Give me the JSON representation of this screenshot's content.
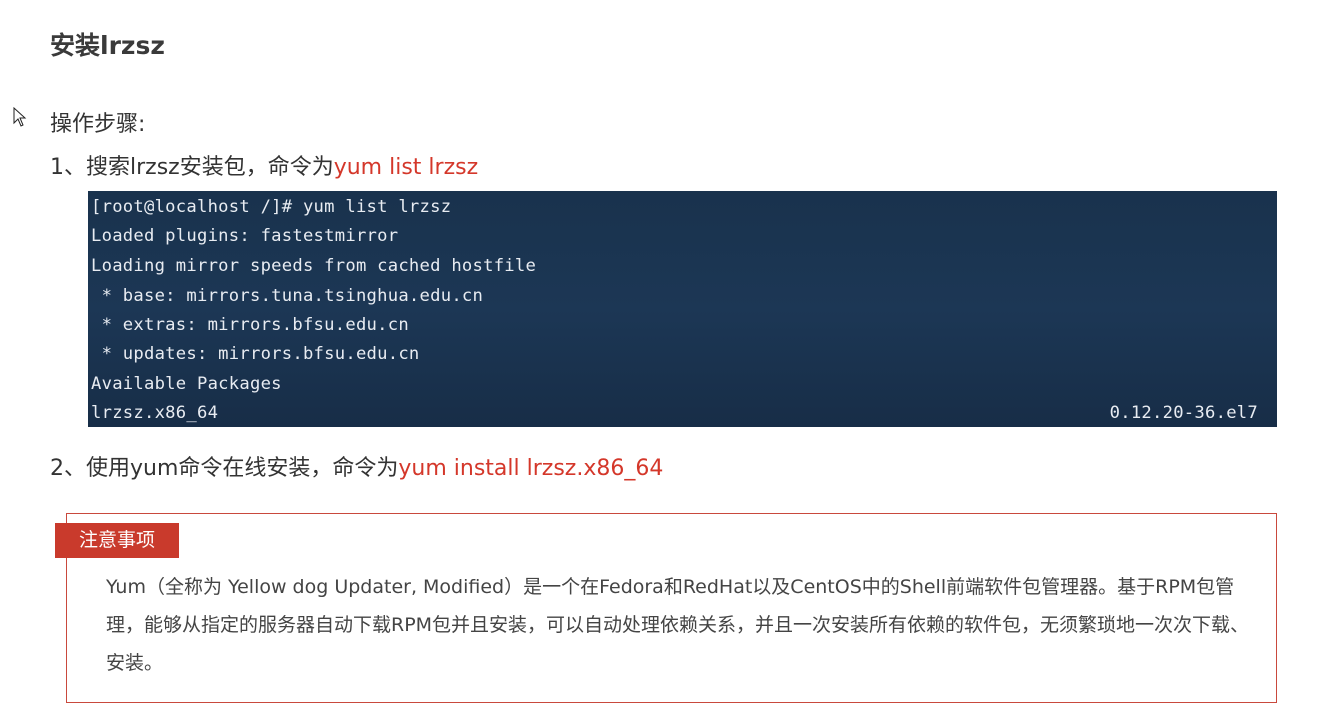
{
  "heading": "安装lrzsz",
  "steps_label": "操作步骤:",
  "step1": {
    "text": "1、搜索lrzsz安装包，命令为",
    "command": "yum list lrzsz"
  },
  "terminal": {
    "lines": [
      "[root@localhost /]# yum list lrzsz",
      "Loaded plugins: fastestmirror",
      "Loading mirror speeds from cached hostfile",
      " * base: mirrors.tuna.tsinghua.edu.cn",
      " * extras: mirrors.bfsu.edu.cn",
      " * updates: mirrors.bfsu.edu.cn",
      "Available Packages",
      "lrzsz.x86_64"
    ],
    "version": "0.12.20-36.el7"
  },
  "step2": {
    "text": "2、使用yum命令在线安装，命令为",
    "command": "yum install lrzsz.x86_64"
  },
  "note": {
    "tag": "注意事项",
    "text": "Yum（全称为 Yellow dog Updater, Modified）是一个在Fedora和RedHat以及CentOS中的Shell前端软件包管理器。基于RPM包管理，能够从指定的服务器自动下载RPM包并且安装，可以自动处理依赖关系，并且一次安装所有依赖的软件包，无须繁琐地一次次下载、安装。"
  },
  "colors": {
    "accent": "#d4372a",
    "terminal_bg": "#1a3450",
    "tag_bg": "#c93a2c"
  }
}
